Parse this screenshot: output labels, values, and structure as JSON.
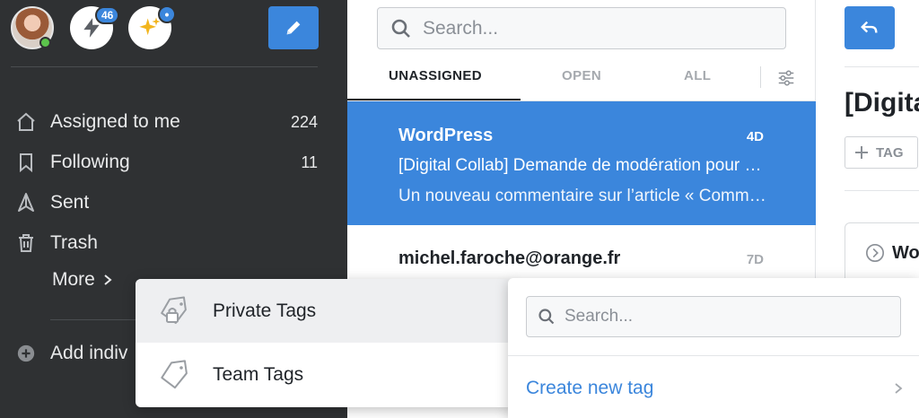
{
  "sidebar": {
    "notifications_badge": "46",
    "ai_badge": "•",
    "nav_items": [
      {
        "label": "Assigned to me",
        "count": "224",
        "icon": "home-icon"
      },
      {
        "label": "Following",
        "count": "11",
        "icon": "bookmark-icon"
      },
      {
        "label": "Sent",
        "count": "",
        "icon": "send-icon"
      },
      {
        "label": "Trash",
        "count": "",
        "icon": "trash-icon"
      }
    ],
    "more_label": "More",
    "add_label": "Add indiv"
  },
  "list": {
    "search_placeholder": "Search...",
    "tabs": [
      {
        "label": "UNASSIGNED",
        "active": true
      },
      {
        "label": "OPEN",
        "active": false
      },
      {
        "label": "ALL",
        "active": false
      }
    ],
    "conversations": [
      {
        "from": "WordPress",
        "age": "4D",
        "subject": "[Digital Collab] Demande de modération pour « Comment écrire un",
        "preview": "Un nouveau commentaire sur l’article « Comment écrire un article",
        "selected": true
      },
      {
        "from": "michel.faroche@orange.fr",
        "age": "7D",
        "subject": "",
        "preview": "",
        "selected": false
      }
    ]
  },
  "detail": {
    "title": "[Digita",
    "tag_button": "TAG",
    "card_text": "Wo"
  },
  "tag_menu": {
    "items": [
      {
        "label": "Private Tags",
        "icon": "private-tag-icon"
      },
      {
        "label": "Team Tags",
        "icon": "tag-icon"
      }
    ]
  },
  "tag_submenu": {
    "search_placeholder": "Search...",
    "create_label": "Create new tag"
  },
  "colors": {
    "accent": "#3b86dc",
    "sidebar_bg": "#2f3133",
    "presence": "#5cc44c"
  }
}
